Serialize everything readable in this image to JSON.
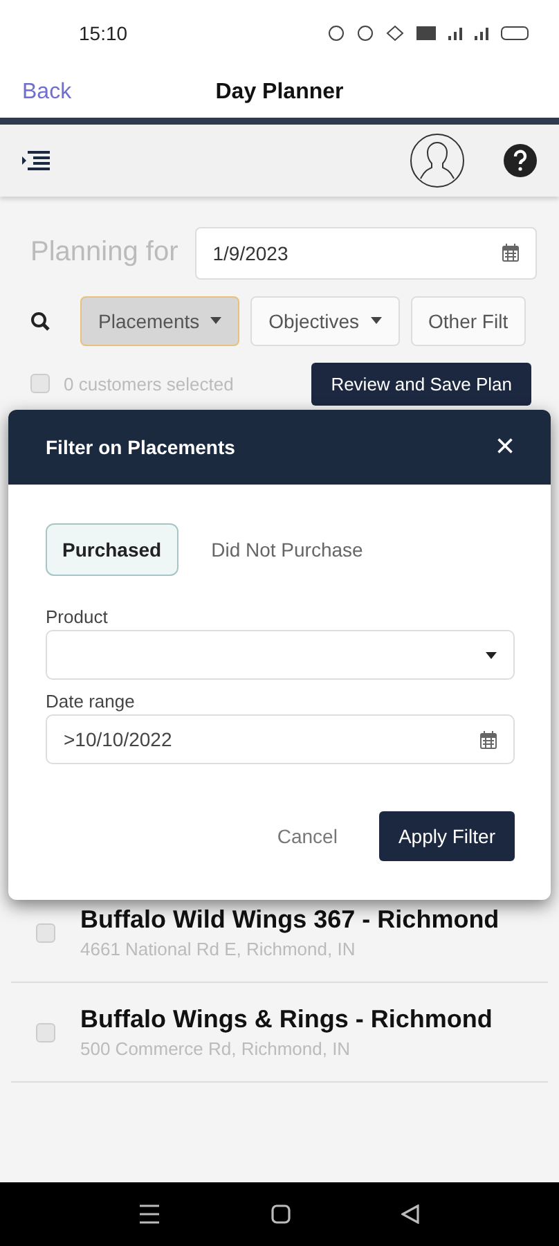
{
  "status_bar": {
    "time": "15:10"
  },
  "header": {
    "back": "Back",
    "title": "Day Planner"
  },
  "planning": {
    "label": "Planning for",
    "date": "1/9/2023"
  },
  "filters": [
    {
      "label": "Placements",
      "selected": true
    },
    {
      "label": "Objectives",
      "selected": false
    },
    {
      "label": "Other Filt",
      "selected": false
    }
  ],
  "selection": {
    "label": "0 customers selected",
    "checked": false,
    "action": "Review and Save Plan"
  },
  "modal": {
    "title": "Filter on Placements",
    "close": "×",
    "toggles": [
      {
        "label": "Purchased",
        "selected": true
      },
      {
        "label": "Did Not Purchase",
        "selected": false
      }
    ],
    "product": {
      "label": "Product"
    },
    "date_range": {
      "label": "Date range",
      "value": ">10/10/2022"
    },
    "cancel": "Cancel",
    "apply": "Apply Filter"
  },
  "customers": [
    {
      "name": "Buffalo Wild Wings 367 - Richmond",
      "address": "4661 National Rd E, Richmond, IN",
      "checked": false
    },
    {
      "name": "Buffalo Wings & Rings - Richmond",
      "address": "500 Commerce Rd, Richmond, IN",
      "checked": false
    }
  ]
}
